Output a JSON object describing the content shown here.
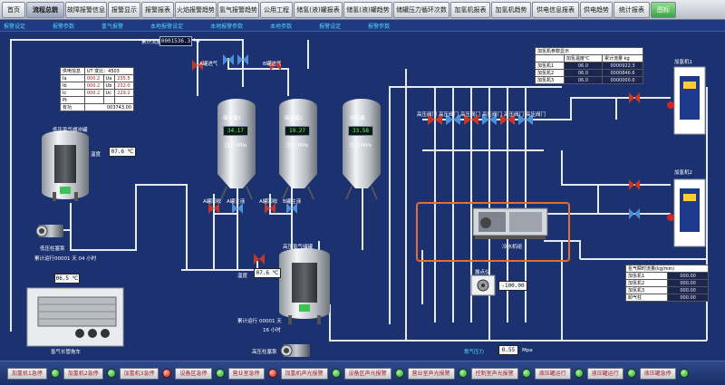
{
  "nav": {
    "tabs": [
      "首页",
      "流程总貌",
      "故障报警信息",
      "报警显示",
      "报警报表",
      "火焰报警趋势",
      "氢气报警趋势",
      "公用工程",
      "储氢(液)罐报表",
      "储氢(液)罐趋势",
      "储罐压力循环次数",
      "加氢机报表",
      "加氢机趋势",
      "供电信息报表",
      "供电趋势",
      "统计报表",
      "图标"
    ],
    "active_index": 1
  },
  "subbar": [
    "报警设定",
    "报警参数",
    "氢气报警",
    "本地报警设定",
    "本地报警参数",
    "本地参数",
    "报警设定",
    "报警参数"
  ],
  "bottom": {
    "buttons": [
      "加氢机1急停",
      "加氢机2急停",
      "加氢机3急停",
      "设备区急停",
      "营业室急停",
      "加氢机声光报警",
      "设备区声光报警",
      "营业室声光报警",
      "控制室声光报警",
      "液压罐运行",
      "液压罐运行",
      "液压罐急停"
    ],
    "lamp_colors": [
      "g",
      "g",
      "r",
      "g",
      "g",
      "r",
      "g",
      "g",
      "g",
      "g",
      "g",
      "g"
    ]
  },
  "power_panel": {
    "title": "供电信息",
    "header2": "UT 变比：4503",
    "rows": [
      {
        "k": "Ia",
        "v1": "000.2",
        "u": "Ua",
        "v2": "235.5"
      },
      {
        "k": "Ib",
        "v1": "000.2",
        "u": "Ub",
        "v2": "232.0"
      },
      {
        "k": "Ic",
        "v1": "000.2",
        "u": "Uc",
        "v2": "229.2"
      },
      {
        "k": "Pt",
        "v1": "",
        "u": "",
        "v2": ""
      },
      {
        "k": "有功",
        "v1": "",
        "u": "",
        "v2": "003743.00"
      }
    ]
  },
  "buffer_tank": {
    "label": "低压氢气缓冲罐",
    "temp_label": "温度",
    "temp_value": "07.6 ℃",
    "pump_label": "低压柱塞泵",
    "runtime_label": "累计运行",
    "runtime_value": "00001 天 04 小时"
  },
  "trailer": {
    "temp_value": "06.5 ℃",
    "label": "氢气长管拖车"
  },
  "inlet_flow": {
    "label": "累计流量",
    "value": "0001536.3",
    "unit": "kg"
  },
  "storage": {
    "tanks": [
      {
        "name": "储氢罐1",
        "value": "34.17",
        "unit": "压力 MPa"
      },
      {
        "name": "储氢罐2",
        "value": "19.27",
        "unit": "压力 MPa"
      },
      {
        "name": "排空罐",
        "value": "33.58",
        "unit": "压力 MPa"
      }
    ],
    "valve_labels_top": [
      "A罐进气",
      "B罐进气"
    ],
    "valve_labels_bottom": [
      "A罐回收",
      "A罐注液",
      "A罐回收",
      "B罐注液"
    ]
  },
  "hp_tank": {
    "label": "高压氢气储罐",
    "temp_label": "温度",
    "temp_value": "07.6 ℃",
    "runtime_label": "累计运行",
    "runtime_value": "00001 天",
    "runtime_hours": "16 小时",
    "pump_label": "高压柱塞泵"
  },
  "valves_row": {
    "labels": [
      "高压阀门",
      "高压阀门",
      "高压阀门",
      "高压阀门",
      "高压阀门",
      "高压阀门"
    ]
  },
  "chiller": {
    "label": "冷水机组"
  },
  "air_heater": {
    "label": "露点仪",
    "value": "-100.00"
  },
  "n2_pressure": {
    "label": "氮气压力",
    "value": "0.55",
    "unit": "Mpa"
  },
  "dispenser_params": {
    "title": "加氢机参数显示",
    "headers": [
      "",
      "加氢温度℃",
      "累计流量 kg"
    ],
    "rows": [
      {
        "name": "加氢机1",
        "t": "06.0",
        "f": "0000922.3"
      },
      {
        "name": "加氢机2",
        "t": "06.0",
        "f": "0000846.6"
      },
      {
        "name": "加氢机3",
        "t": "06.0",
        "f": "0000000.0"
      }
    ]
  },
  "dispensers": [
    {
      "label": "加氢机1"
    },
    {
      "label": "加氢机2"
    }
  ],
  "flow_panel": {
    "title": "氢气瞬时流量(kg/min)",
    "rows": [
      {
        "name": "加氢机1",
        "v": "000.00"
      },
      {
        "name": "加氢机2",
        "v": "000.00"
      },
      {
        "name": "加氢机3",
        "v": "000.00"
      },
      {
        "name": "卸气柱",
        "v": "000.00"
      }
    ]
  }
}
